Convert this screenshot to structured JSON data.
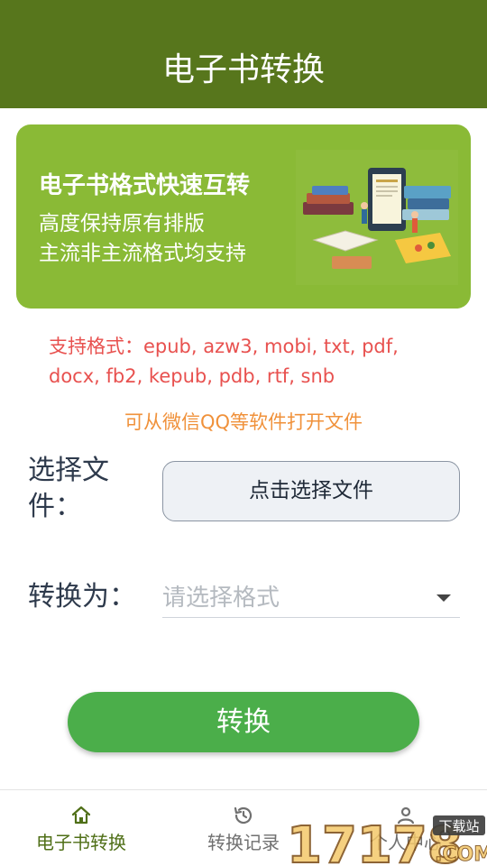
{
  "header": {
    "title": "电子书转换"
  },
  "banner": {
    "heading": "电子书格式快速互转",
    "line1": "高度保持原有排版",
    "line2": "主流非主流格式均支持",
    "illustration_icon": "books-illustration"
  },
  "formats": {
    "line1": "支持格式：epub, azw3, mobi, txt, pdf,",
    "line2": "docx, fb2, kepub, pdb, rtf, snb"
  },
  "hint": "可从微信QQ等软件打开文件",
  "select_file": {
    "label_line1": "选择文",
    "label_line2": "件：",
    "button_label": "点击选择文件"
  },
  "convert_to": {
    "label": "转换为：",
    "placeholder": "请选择格式"
  },
  "convert_button": "转换",
  "bottom_nav": [
    {
      "label": "电子书转换",
      "icon": "home-icon",
      "active": true
    },
    {
      "label": "转换记录",
      "icon": "history-icon",
      "active": false
    },
    {
      "label": "个人中心",
      "icon": "user-icon",
      "active": false
    }
  ],
  "watermark": {
    "text": "17178",
    "tag": "下载站",
    "suffix": ".COM"
  },
  "colors": {
    "header": "#57761c",
    "banner": "#8aba36",
    "formats_text": "#e8514f",
    "hint_text": "#f0913a",
    "convert_button": "#4bae4a",
    "nav_active": "#4f6f17"
  }
}
